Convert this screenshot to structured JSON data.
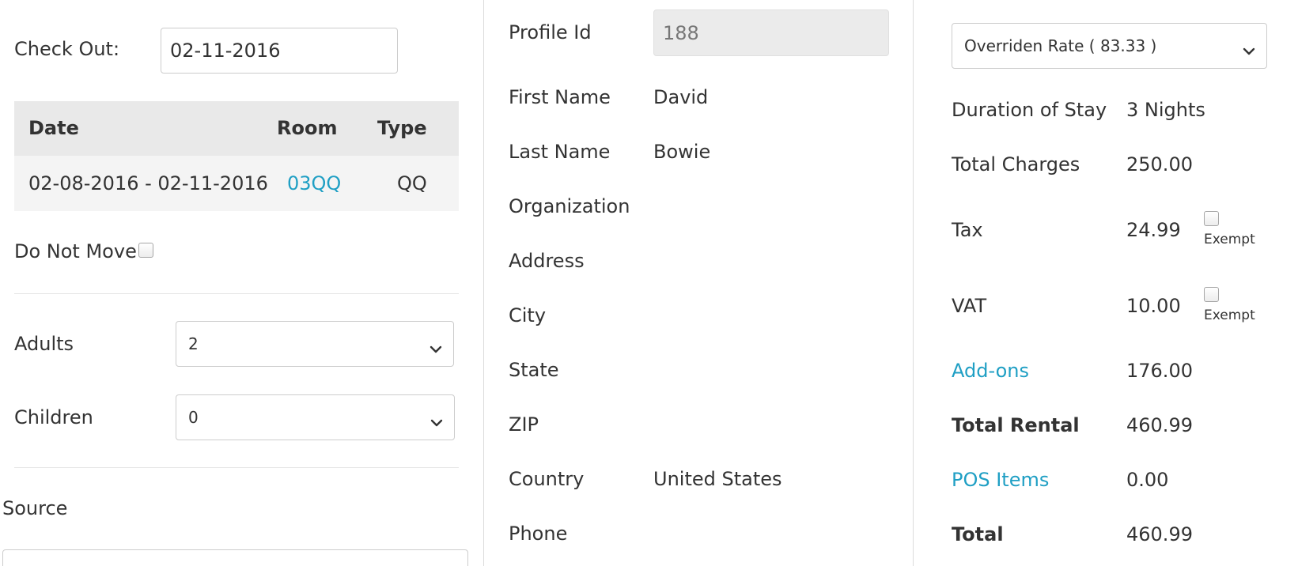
{
  "left": {
    "checkout_label": "Check Out:",
    "checkout_value": "02-11-2016",
    "table": {
      "headers": [
        "Date",
        "Room",
        "Type"
      ],
      "rows": [
        {
          "date": "02-08-2016 - 02-11-2016",
          "room": "03QQ",
          "type": "QQ"
        }
      ]
    },
    "do_not_move_label": "Do Not Move",
    "adults_label": "Adults",
    "adults_value": "2",
    "children_label": "Children",
    "children_value": "0",
    "source_label": "Source"
  },
  "middle": {
    "profile_id_label": "Profile Id",
    "profile_id_value": "188",
    "first_name_label": "First Name",
    "first_name_value": "David",
    "last_name_label": "Last Name",
    "last_name_value": "Bowie",
    "organization_label": "Organization",
    "address_label": "Address",
    "city_label": "City",
    "state_label": "State",
    "zip_label": "ZIP",
    "country_label": "Country",
    "country_value": "United States",
    "phone_label": "Phone"
  },
  "right": {
    "rate_select_value": "Overriden Rate ( 83.33 )",
    "duration_label": "Duration of Stay",
    "duration_value": "3 Nights",
    "total_charges_label": "Total Charges",
    "total_charges_value": "250.00",
    "tax_label": "Tax",
    "tax_value": "24.99",
    "tax_exempt_label": "Exempt",
    "vat_label": "VAT",
    "vat_value": "10.00",
    "vat_exempt_label": "Exempt",
    "addons_label": "Add-ons",
    "addons_value": "176.00",
    "total_rental_label": "Total Rental",
    "total_rental_value": "460.99",
    "pos_items_label": "POS Items",
    "pos_items_value": "0.00",
    "total_label": "Total",
    "total_value": "460.99"
  },
  "colors": {
    "link": "#1f9fc4",
    "table_header_bg": "#e9e9e9",
    "table_row_bg": "#f4f4f4",
    "readonly_bg": "#ebebeb"
  },
  "icons": {
    "select_arrow": "chevron-down-icon"
  }
}
